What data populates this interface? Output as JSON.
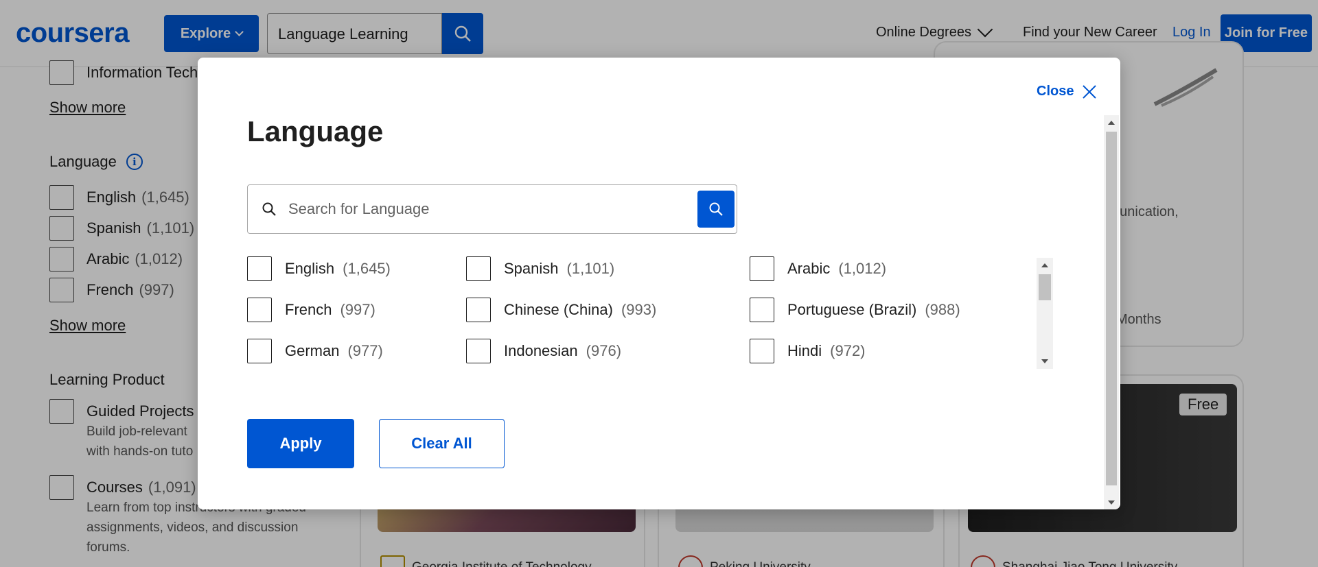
{
  "nav": {
    "logo": "coursera",
    "explore": "Explore",
    "search_value": "Language Learning",
    "online_degrees": "Online Degrees",
    "find_career": "Find your New Career",
    "login": "Log In",
    "join": "Join for Free"
  },
  "sidebar": {
    "top_partial": "Information Tech",
    "show_more_1": "Show more",
    "language_heading": "Language",
    "languages": [
      {
        "label": "English",
        "count": "(1,645)"
      },
      {
        "label": "Spanish",
        "count": "(1,101)"
      },
      {
        "label": "Arabic",
        "count": "(1,012)"
      },
      {
        "label": "French",
        "count": "(997)"
      }
    ],
    "show_more_2": "Show more",
    "product_heading": "Learning Product",
    "guided_label": "Guided Projects",
    "guided_desc": "Build job-relevant with hands-on tuto",
    "courses_label": "Courses",
    "courses_count": "(1,091)",
    "courses_desc": "Learn from top instructors with graded assignments, videos, and discussion forums."
  },
  "cards": {
    "partial_text_1": "nunication,",
    "partial_text_2": "Months",
    "badge": "Free",
    "partner_1": "Georgia Institute of Technology",
    "partner_2": "Peking University",
    "partner_3": "Shanghai Jiao Tong University"
  },
  "modal": {
    "close": "Close",
    "title": "Language",
    "search_placeholder": "Search for Language",
    "options": [
      {
        "label": "English",
        "count": "(1,645)"
      },
      {
        "label": "Spanish",
        "count": "(1,101)"
      },
      {
        "label": "Arabic",
        "count": "(1,012)"
      },
      {
        "label": "French",
        "count": "(997)"
      },
      {
        "label": "Chinese (China)",
        "count": "(993)"
      },
      {
        "label": "Portuguese (Brazil)",
        "count": "(988)"
      },
      {
        "label": "German",
        "count": "(977)"
      },
      {
        "label": "Indonesian",
        "count": "(976)"
      },
      {
        "label": "Hindi",
        "count": "(972)"
      }
    ],
    "apply": "Apply",
    "clear_all": "Clear All"
  },
  "colors": {
    "brand": "#0056d2",
    "text": "#1f1f1f",
    "muted": "#636363"
  }
}
